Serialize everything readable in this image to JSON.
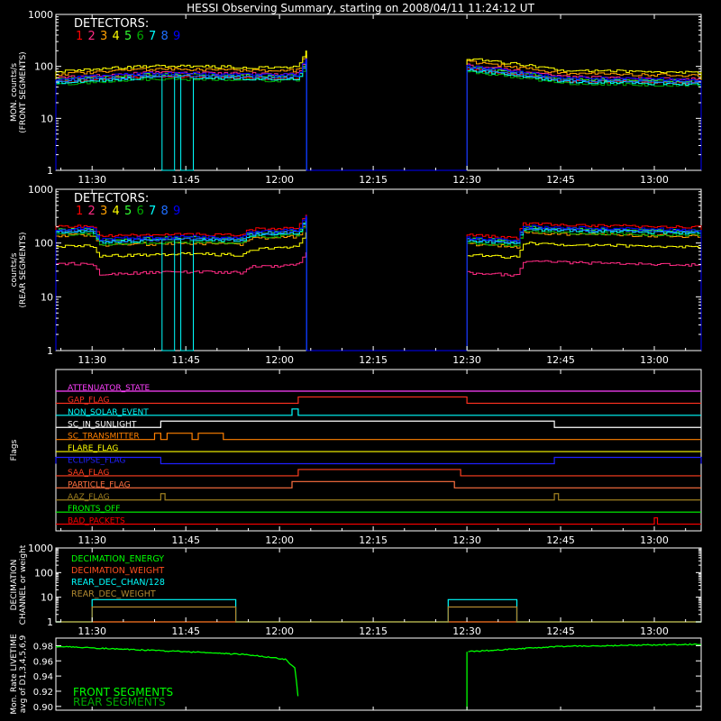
{
  "title": "HESSI Observing Summary, starting on 2008/04/11 11:24:12 UT",
  "time_axis": {
    "start": "11:24:12",
    "end": "13:07:30",
    "ticks": [
      "11:30",
      "11:45",
      "12:00",
      "12:15",
      "12:30",
      "12:45",
      "13:00"
    ],
    "tick_minutes": [
      30,
      45,
      60,
      75,
      90,
      105,
      120
    ]
  },
  "detector_colors": [
    "#ff0000",
    "#ff2a82",
    "#ffa000",
    "#ffff00",
    "#32ff32",
    "#00aa00",
    "#00ffff",
    "#1e6eff",
    "#0000ff"
  ],
  "detectors_label": "DETECTORS:",
  "detector_numbers": [
    "1",
    "2",
    "3",
    "4",
    "5",
    "6",
    "7",
    "8",
    "9"
  ],
  "chart_data": [
    {
      "type": "line",
      "id": "front",
      "ylabel_lines": [
        "MON. counts/s",
        "(FRONT SEGMENTS)"
      ],
      "yscale": "log",
      "ylim": [
        1,
        1000
      ],
      "yticks": [
        "1",
        "10",
        "100",
        "1000"
      ],
      "segments": [
        {
          "x": [
            "11:24:12",
            "11:40",
            "12:00",
            "12:03",
            "12:04:20"
          ],
          "shape": [
            1.0,
            1.28,
            1.18,
            1.2,
            2.5
          ]
        },
        {
          "x": [
            "12:30",
            "12:45",
            "13:07:30"
          ],
          "shape": [
            1.75,
            1.05,
            0.95
          ]
        }
      ],
      "series": [
        {
          "name": "1",
          "level": 50
        },
        {
          "name": "2",
          "level": 60
        },
        {
          "name": "3",
          "level": 70
        },
        {
          "name": "4",
          "level": 80
        },
        {
          "name": "5",
          "level": 55
        },
        {
          "name": "6",
          "level": 45
        },
        {
          "name": "7",
          "level": 48,
          "dropouts": [
            [
              "11:41",
              "11:43"
            ],
            [
              "11:44",
              "11:46"
            ]
          ]
        },
        {
          "name": "8",
          "level": 52
        },
        {
          "name": "9",
          "level": 58
        }
      ]
    },
    {
      "type": "line",
      "id": "rear",
      "ylabel_lines": [
        "counts/s",
        "(REAR SEGMENTS)"
      ],
      "yscale": "log",
      "ylim": [
        1,
        1000
      ],
      "yticks": [
        "1",
        "10",
        "100",
        "1000"
      ],
      "segments": [
        {
          "x": [
            "11:24:12",
            "11:30",
            "11:31",
            "11:45",
            "11:54",
            "11:55",
            "12:03",
            "12:04:20"
          ],
          "shape": [
            1.45,
            1.5,
            0.95,
            1.05,
            1.0,
            1.28,
            1.4,
            2.6
          ]
        },
        {
          "x": [
            "12:30",
            "12:38",
            "12:39",
            "12:45",
            "13:07:30"
          ],
          "shape": [
            1.0,
            0.9,
            1.65,
            1.55,
            1.4
          ]
        }
      ],
      "series": [
        {
          "name": "1",
          "level": 140
        },
        {
          "name": "2",
          "level": 28
        },
        {
          "name": "3",
          "level": 95
        },
        {
          "name": "4",
          "level": 60
        },
        {
          "name": "5",
          "level": 120
        },
        {
          "name": "6",
          "level": 100
        },
        {
          "name": "7",
          "level": 110,
          "dropouts": [
            [
              "11:41",
              "11:43"
            ],
            [
              "11:44",
              "11:46"
            ]
          ]
        },
        {
          "name": "8",
          "level": 115
        },
        {
          "name": "9",
          "level": 125
        }
      ]
    },
    {
      "type": "line",
      "id": "flags",
      "ylabel_lines": [
        "Flags"
      ],
      "flags": [
        {
          "name": "ATTENUATOR_STATE",
          "color": "#ff40ff",
          "highs": []
        },
        {
          "name": "GAP_FLAG",
          "color": "#ff3020",
          "highs": [
            [
              "12:03",
              "12:30"
            ]
          ]
        },
        {
          "name": "NON_SOLAR_EVENT",
          "color": "#00ffff",
          "highs": [
            [
              "12:02",
              "12:03"
            ]
          ]
        },
        {
          "name": "SC_IN_SUNLIGHT",
          "color": "#ffffff",
          "highs": [
            [
              "11:41",
              "12:44"
            ]
          ]
        },
        {
          "name": "SC_TRANSMITTER",
          "color": "#ff8000",
          "highs": [
            [
              "11:40",
              "11:41"
            ],
            [
              "11:42",
              "11:46"
            ],
            [
              "11:47",
              "11:51"
            ]
          ]
        },
        {
          "name": "FLARE_FLAG",
          "color": "#ffff00",
          "highs": []
        },
        {
          "name": "ECLIPSE_FLAG",
          "color": "#2020ff",
          "highs": [
            [
              "11:24:12",
              "11:41"
            ],
            [
              "12:44",
              "13:07:30"
            ]
          ]
        },
        {
          "name": "SAA_FLAG",
          "color": "#ff4020",
          "highs": [
            [
              "12:03",
              "12:29"
            ]
          ]
        },
        {
          "name": "PARTICLE_FLAG",
          "color": "#ff7040",
          "highs": [
            [
              "12:02",
              "12:28"
            ]
          ]
        },
        {
          "name": "AAZ_FLAG",
          "color": "#a08020",
          "highs": [
            [
              "11:41",
              "11:41:40"
            ],
            [
              "12:44",
              "12:44:40"
            ]
          ]
        },
        {
          "name": "FRONTS_OFF",
          "color": "#00ff00",
          "highs": []
        },
        {
          "name": "BAD_PACKETS",
          "color": "#ff0000",
          "highs": [
            [
              "13:00",
              "13:00:30"
            ]
          ]
        }
      ]
    },
    {
      "type": "line",
      "id": "decimation",
      "ylabel_lines": [
        "DECIMATION",
        "CHANNEL or weight"
      ],
      "yscale": "log",
      "ylim": [
        1,
        1000
      ],
      "yticks": [
        "1",
        "10",
        "100",
        "1000"
      ],
      "series": [
        {
          "name": "DECIMATION_ENERGY",
          "color": "#00ff00",
          "steps": []
        },
        {
          "name": "DECIMATION_WEIGHT",
          "color": "#ff5020",
          "steps": []
        },
        {
          "name": "REAR_DEC_CHAN/128",
          "color": "#00ffff",
          "steps": [
            [
              "11:30",
              "11:53",
              8
            ],
            [
              "12:27",
              "12:38",
              8
            ]
          ]
        },
        {
          "name": "REAR_DEC_WEIGHT",
          "color": "#b08830",
          "steps": [
            [
              "11:30",
              "11:53",
              4
            ],
            [
              "12:27",
              "12:38",
              4
            ]
          ]
        }
      ]
    },
    {
      "type": "line",
      "id": "livetime",
      "ylabel_lines": [
        "Mon. Rate LIVETIME",
        "avg of D1,3,4,5,6,9"
      ],
      "ylim": [
        0.895,
        0.99
      ],
      "yticks": [
        "0.90",
        "0.92",
        "0.94",
        "0.96",
        "0.98"
      ],
      "series": [
        {
          "name": "FRONT SEGMENTS",
          "color": "#00ff00",
          "points": [
            [
              "11:24:12",
              0.979
            ],
            [
              "11:45",
              0.972
            ],
            [
              "11:55",
              0.968
            ],
            [
              "12:01",
              0.962
            ],
            [
              "12:02:30",
              0.95
            ],
            [
              "12:03",
              0.91
            ],
            [
              "12:03:10",
              0.895
            ],
            [
              "12:30",
              0.972
            ],
            [
              "12:45",
              0.979
            ],
            [
              "13:07:30",
              0.982
            ]
          ]
        },
        {
          "name": "REAR SEGMENTS",
          "color": "#00aa00",
          "points": []
        }
      ]
    }
  ]
}
